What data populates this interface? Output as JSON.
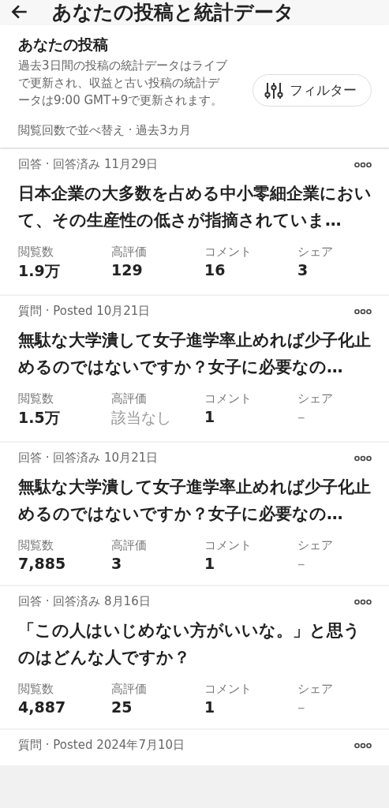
{
  "header": {
    "title": "あなたの投稿と統計データ"
  },
  "summary": {
    "title": "あなたの投稿",
    "description": "過去3日間の投稿の統計データはライブで更新され、収益と古い投稿の統計データは9:00 GMT+9で更新されます。",
    "filter_button": "フィルター",
    "sort": "閲覧回数で並べ替え · 過去3カ月"
  },
  "posts": [
    {
      "meta": "回答 · 回答済み 11月29日",
      "title": "日本企業の大多数を占める中小零細企業において、その生産性の低さが指摘されていま…",
      "stats": [
        {
          "label": "閲覧数",
          "value": "1.9万",
          "muted": false
        },
        {
          "label": "高評価",
          "value": "129",
          "muted": false
        },
        {
          "label": "コメント",
          "value": "16",
          "muted": false
        },
        {
          "label": "シェア",
          "value": "3",
          "muted": false
        }
      ]
    },
    {
      "meta": "質問 · Posted 10月21日",
      "title": "無駄な大学潰して女子進学率止めれば少子化止めるのではないですか？女子に必要なの…",
      "stats": [
        {
          "label": "閲覧数",
          "value": "1.5万",
          "muted": false
        },
        {
          "label": "高評価",
          "value": "該当なし",
          "muted": true
        },
        {
          "label": "コメント",
          "value": "1",
          "muted": false
        },
        {
          "label": "シェア",
          "value": "–",
          "muted": true
        }
      ]
    },
    {
      "meta": "回答 · 回答済み 10月21日",
      "title": "無駄な大学潰して女子進学率止めれば少子化止めるのではないですか？女子に必要なの…",
      "stats": [
        {
          "label": "閲覧数",
          "value": "7,885",
          "muted": false
        },
        {
          "label": "高評価",
          "value": "3",
          "muted": false
        },
        {
          "label": "コメント",
          "value": "1",
          "muted": false
        },
        {
          "label": "シェア",
          "value": "–",
          "muted": true
        }
      ]
    },
    {
      "meta": "回答 · 回答済み 8月16日",
      "title": "「この人はいじめない方がいいな。」と思うのはどんな人ですか？",
      "stats": [
        {
          "label": "閲覧数",
          "value": "4,887",
          "muted": false
        },
        {
          "label": "高評価",
          "value": "25",
          "muted": false
        },
        {
          "label": "コメント",
          "value": "1",
          "muted": false
        },
        {
          "label": "シェア",
          "value": "–",
          "muted": true
        }
      ]
    },
    {
      "meta": "質問 · Posted 2024年7月10日"
    }
  ]
}
